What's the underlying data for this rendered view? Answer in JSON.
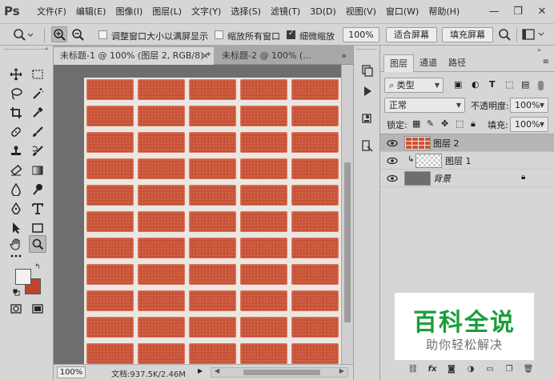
{
  "app": {
    "logo": "Ps"
  },
  "menu": [
    "文件(F)",
    "编辑(E)",
    "图像(I)",
    "图层(L)",
    "文字(Y)",
    "选择(S)",
    "滤镜(T)",
    "3D(D)",
    "视图(V)",
    "窗口(W)",
    "帮助(H)"
  ],
  "window_controls": {
    "minimize": "—",
    "restore": "❐",
    "close": "✕"
  },
  "options": {
    "resize_windows": {
      "label": "调整窗口大小以满屏显示",
      "checked": false
    },
    "zoom_all": {
      "label": "缩放所有窗口",
      "checked": false
    },
    "scrubby_zoom": {
      "label": "细微缩放",
      "checked": true
    },
    "zoom_value": "100%",
    "fit_screen": "适合屏幕",
    "fill_screen": "填充屏幕"
  },
  "tools": [
    "move-tool",
    "marquee-tool",
    "lasso-tool",
    "magic-wand-tool",
    "crop-tool",
    "eyedropper-tool",
    "healing-tool",
    "brush-tool",
    "stamp-tool",
    "history-brush-tool",
    "eraser-tool",
    "gradient-tool",
    "blur-tool",
    "dodge-tool",
    "pen-tool",
    "type-tool",
    "path-select-tool",
    "shape-tool",
    "hand-tool",
    "zoom-tool"
  ],
  "colors": {
    "foreground": "#f2f2f2",
    "background": "#c0442a",
    "brick": "#c9553a",
    "accent_green": "#1a9e3c"
  },
  "documents": {
    "tabs": [
      {
        "label": "未标题-1 @ 100% (图层 2, RGB/8) *",
        "close": "×",
        "active": true
      },
      {
        "label": "未标题-2 @ 100% (...",
        "close": "»",
        "active": false
      }
    ],
    "status_zoom": "100%",
    "status_doc": "文档:937.5K/2.46M"
  },
  "panel": {
    "tabs": [
      "图层",
      "通道",
      "路径"
    ],
    "filter_kind": "类型",
    "blend_mode": "正常",
    "opacity_label": "不透明度:",
    "opacity_value": "100%",
    "lock_label": "锁定:",
    "fill_label": "填充:",
    "fill_value": "100%",
    "layers": [
      {
        "name": "图层 2",
        "selected": true,
        "visible": true
      },
      {
        "name": "图层 1",
        "selected": false,
        "visible": true,
        "clipped": true
      },
      {
        "name": "背景",
        "selected": false,
        "visible": true,
        "locked": true
      }
    ],
    "bottom_icons": [
      "link-icon",
      "fx-icon",
      "mask-icon",
      "adjustment-icon",
      "group-icon",
      "new-layer-icon",
      "trash-icon"
    ]
  },
  "watermark": {
    "title": "百科全说",
    "subtitle": "助你轻松解决"
  }
}
